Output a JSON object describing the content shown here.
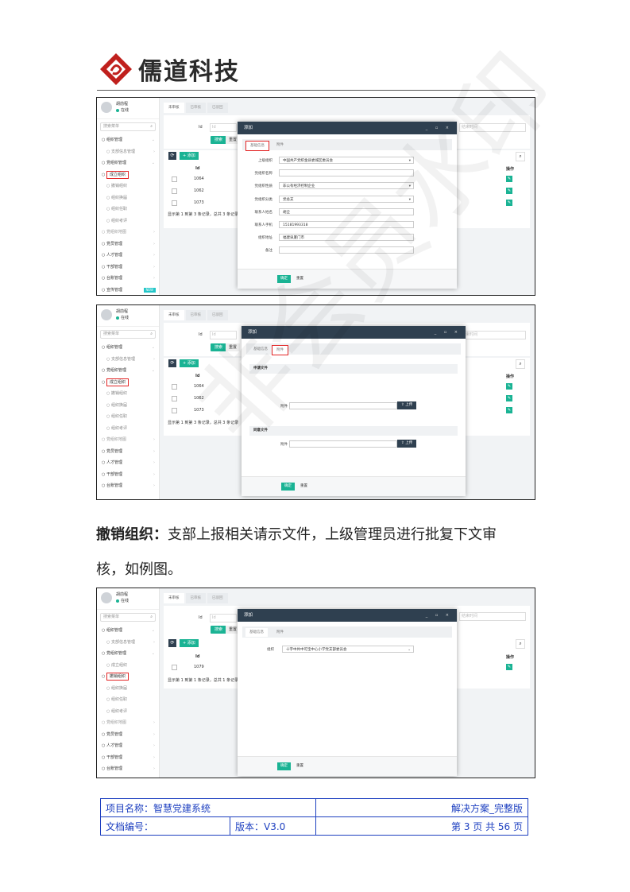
{
  "header": {
    "logo_text": "儒道科技"
  },
  "app": {
    "user_name": "胡前程",
    "user_status": "在线",
    "search_placeholder": "搜索菜单",
    "tabs": [
      "未审核",
      "已审核",
      "已驳回"
    ],
    "query_label": "Id",
    "query_placeholder": "Id",
    "search_btn": "搜索",
    "reset_btn": "重置",
    "add_btn": "+ 添加",
    "op_header": "操作",
    "id_header": "Id",
    "time_placeholder": "结束时间"
  },
  "sidebar_a": [
    {
      "label": "组织管理",
      "chev": "⌄"
    },
    {
      "label": "支部信息管理",
      "chev": "›",
      "style": "sub"
    },
    {
      "label": "党组织管理",
      "chev": "⌄"
    },
    {
      "label": "成立组织",
      "style": "active"
    },
    {
      "label": "撤销组织",
      "style": "sub"
    },
    {
      "label": "组织换届",
      "style": "sub"
    },
    {
      "label": "组织任职",
      "style": "sub"
    },
    {
      "label": "组织考评",
      "style": "sub"
    },
    {
      "label": "党组织地图",
      "chev": "›",
      "style": "grey"
    },
    {
      "label": "党员管理",
      "chev": "›"
    },
    {
      "label": "人才管理",
      "chev": "›"
    },
    {
      "label": "干部管理",
      "chev": "›"
    },
    {
      "label": "台账管理",
      "chev": "›"
    },
    {
      "label": "宣传管理",
      "badge": "NEW"
    }
  ],
  "sidebar_c": [
    {
      "label": "组织管理",
      "chev": "⌄"
    },
    {
      "label": "支部信息管理",
      "chev": "›",
      "style": "sub"
    },
    {
      "label": "党组织管理",
      "chev": "⌄"
    },
    {
      "label": "成立组织",
      "style": "sub"
    },
    {
      "label": "撤销组织",
      "style": "active"
    },
    {
      "label": "组织换届",
      "style": "sub"
    },
    {
      "label": "组织任职",
      "style": "sub"
    },
    {
      "label": "组织考评",
      "style": "sub"
    },
    {
      "label": "党组织地图",
      "chev": "›",
      "style": "grey"
    },
    {
      "label": "党员管理",
      "chev": "›"
    },
    {
      "label": "人才管理",
      "chev": "›"
    },
    {
      "label": "干部管理",
      "chev": "›"
    },
    {
      "label": "台账管理",
      "chev": "›"
    }
  ],
  "table_a": {
    "ids": [
      "1064",
      "1062",
      "1073"
    ],
    "footer": "显示第 1 到第 3 条记录，总共 3 条记录"
  },
  "table_c": {
    "ids": [
      "1079"
    ],
    "footer": "显示第 1 到第 1 条记录，总共 1 条记录"
  },
  "modal": {
    "title": "添加",
    "tab_basic": "基础信息",
    "tab_attach": "附件",
    "ok": "确定",
    "reset": "重置",
    "fields": [
      {
        "label": "上级组织",
        "value": "中国共产党织金县委城区委员会",
        "select": true
      },
      {
        "label": "党组织名称",
        "value": ""
      },
      {
        "label": "党组织性质",
        "value": "非公有经济控制企业",
        "select": true
      },
      {
        "label": "党组织分类",
        "value": "党总支",
        "select": true
      },
      {
        "label": "联系人姓名",
        "value": "胡全"
      },
      {
        "label": "联系人手机",
        "value": "15181993318"
      },
      {
        "label": "组织地址",
        "value": "福建泉厦门市"
      },
      {
        "label": "备注",
        "value": ""
      }
    ],
    "section_apply": "申请文件",
    "section_approve": "同意文件",
    "attach_label": "附件",
    "upload_btn": "上传",
    "org_label": "组织",
    "org_value": "十字中共中可宝中心小学党支部委员会"
  },
  "body": {
    "heading": "撤销组织：",
    "line1": "支部上报相关请示文件，上级管理员进行批复下文审",
    "line2": "核，如例图。"
  },
  "watermark": "非会员水印",
  "footer_table": {
    "project_label": "项目名称：智慧党建系统",
    "solution": "解决方案_完整版",
    "doc_label": "文档编号：",
    "version": "版本：V3.0",
    "page": "第 3 页 共 56 页"
  }
}
